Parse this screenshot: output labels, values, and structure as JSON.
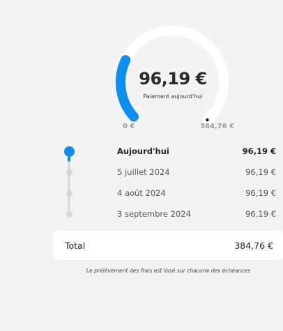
{
  "gauge": {
    "amount": "96,19 €",
    "caption": "Paiement aujourd'hui",
    "min_label": "0 €",
    "max_label": "384,76 €",
    "progress": 0.25,
    "colors": {
      "progress": "#0d8ff0",
      "track": "#ffffff",
      "end_dot": "#0b1b3a"
    }
  },
  "schedule": [
    {
      "label": "Aujourd'hui",
      "amount": "96,19 €",
      "status": "active"
    },
    {
      "label": "5 juillet 2024",
      "amount": "96,19 €",
      "status": "pending"
    },
    {
      "label": "4 août 2024",
      "amount": "96,19 €",
      "status": "pending"
    },
    {
      "label": "3 septembre 2024",
      "amount": "96,19 €",
      "status": "pending"
    }
  ],
  "total": {
    "label": "Total",
    "amount": "384,76 €"
  },
  "note": "Le prélèvement des frais est lissé sur chacune des échéances",
  "colors": {
    "accent": "#0d8ff0",
    "background": "#f3f3f3",
    "inactive": "#d5d5d5"
  }
}
